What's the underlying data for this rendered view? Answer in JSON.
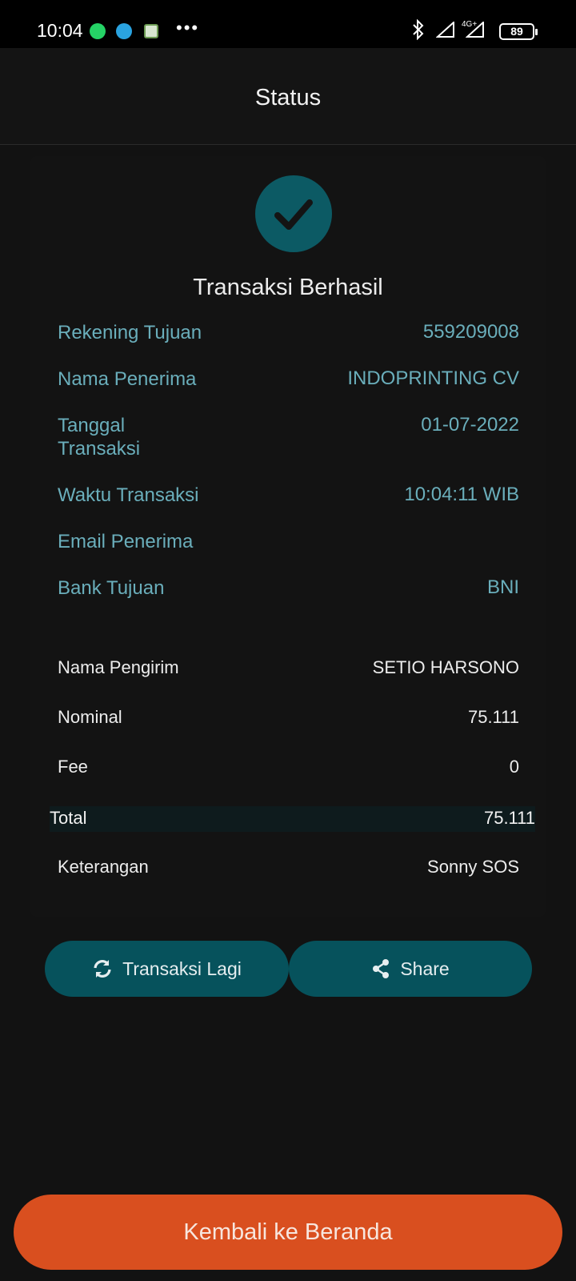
{
  "status_bar": {
    "time": "10:04",
    "network": "4G+",
    "battery": "89",
    "icons": [
      "whatsapp-icon",
      "telegram-icon",
      "store-icon",
      "more-dots-icon",
      "bluetooth-icon",
      "signal-icon",
      "signal-icon",
      "battery-icon"
    ]
  },
  "header": {
    "title": "Status"
  },
  "result": {
    "title": "Transaksi Berhasil",
    "icon": "check-icon",
    "icon_bg": "#0c5a64"
  },
  "recipient": [
    {
      "label": "Rekening Tujuan",
      "value": "559209008"
    },
    {
      "label": "Nama Penerima",
      "value": "INDOPRINTING CV"
    },
    {
      "label": "Tanggal Transaksi",
      "value": "01-07-2022"
    },
    {
      "label": "Waktu Transaksi",
      "value": "10:04:11 WIB"
    },
    {
      "label": "Email Penerima",
      "value": ""
    },
    {
      "label": "Bank Tujuan",
      "value": "BNI"
    }
  ],
  "sender": [
    {
      "label": "Nama Pengirim",
      "value": "SETIO HARSONO"
    },
    {
      "label": "Nominal",
      "value": "75.111"
    },
    {
      "label": "Fee",
      "value": "0"
    },
    {
      "label": "Total",
      "value": "75.111"
    },
    {
      "label": "Keterangan",
      "value": "Sonny SOS"
    }
  ],
  "actions": {
    "again_label": "Transaksi Lagi",
    "again_icon": "refresh-icon",
    "share_label": "Share",
    "share_icon": "share-icon"
  },
  "home_button": {
    "label": "Kembali ke Beranda"
  },
  "colors": {
    "accent": "#06525c",
    "label_teal": "#6aaebb",
    "home_orange": "#d94f1f",
    "background": "#121212"
  }
}
